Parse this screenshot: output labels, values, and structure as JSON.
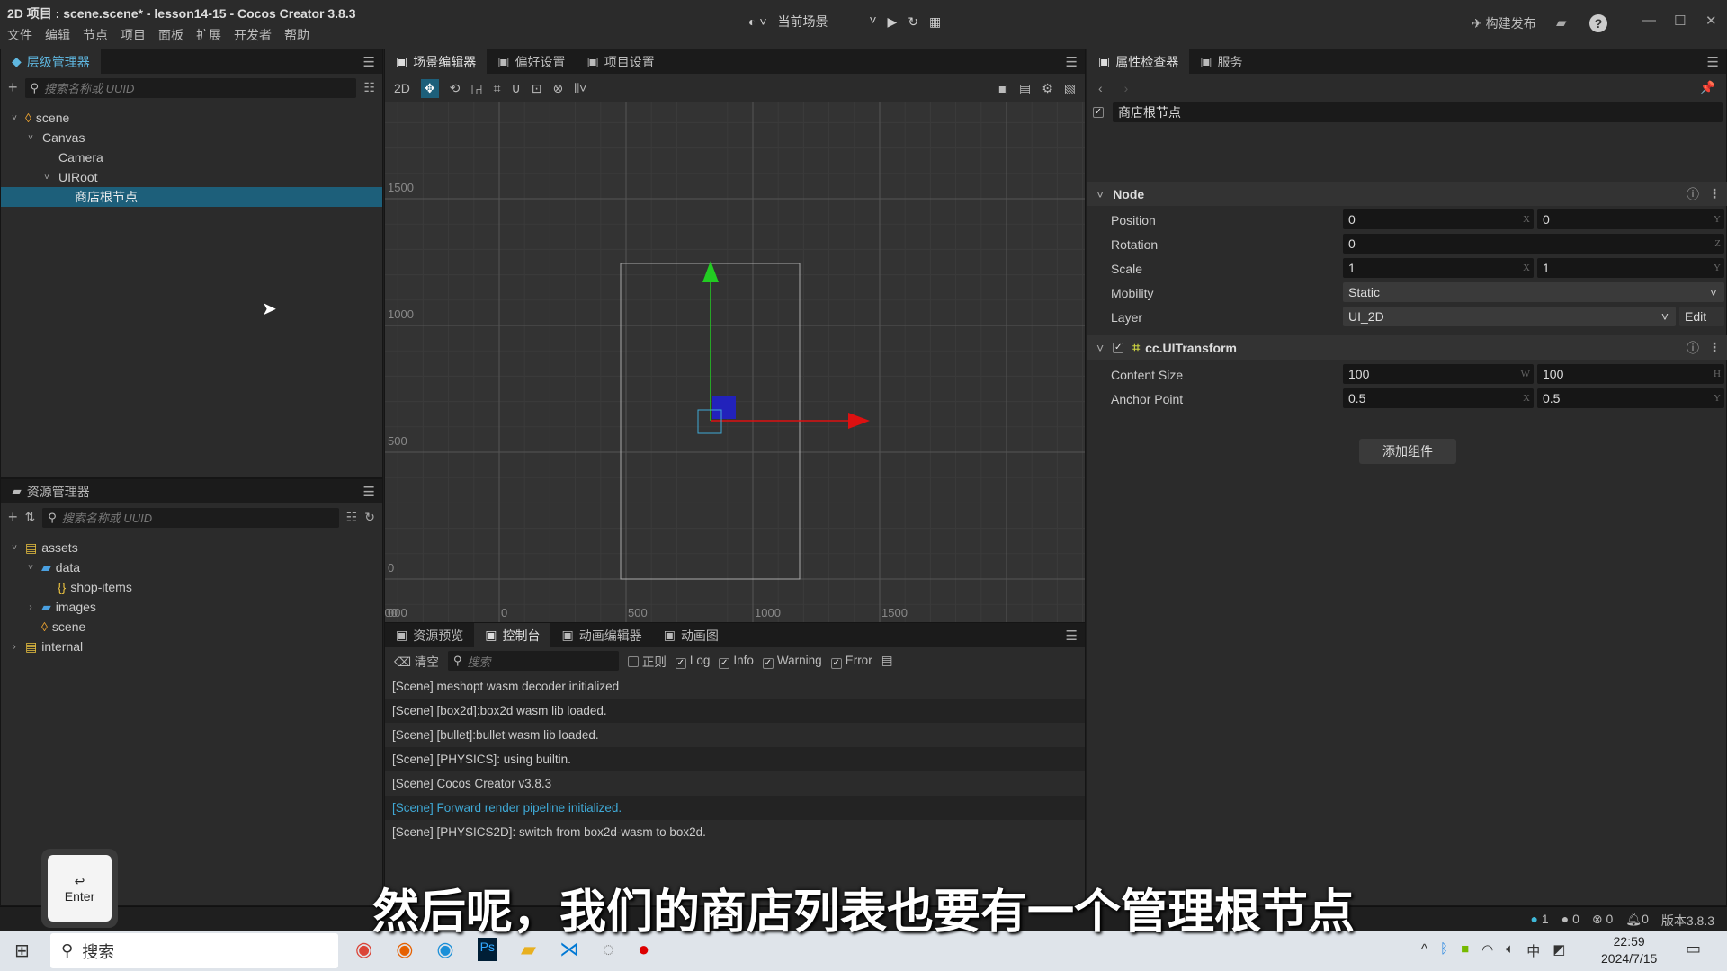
{
  "window": {
    "title": "2D 项目 : scene.scene* - lesson14-15 - Cocos Creator 3.8.3",
    "menu": [
      "文件",
      "编辑",
      "节点",
      "项目",
      "面板",
      "扩展",
      "开发者",
      "帮助"
    ],
    "scene_select": "当前场景",
    "build_label": "构建发布"
  },
  "hierarchy": {
    "tab": "层级管理器",
    "search_placeholder": "搜索名称或 UUID",
    "items": [
      {
        "label": "scene",
        "depth": 0
      },
      {
        "label": "Canvas",
        "depth": 1
      },
      {
        "label": "Camera",
        "depth": 2
      },
      {
        "label": "UIRoot",
        "depth": 2
      },
      {
        "label": "商店根节点",
        "depth": 3,
        "selected": true
      }
    ]
  },
  "assets": {
    "tab": "资源管理器",
    "search_placeholder": "搜索名称或 UUID",
    "items": [
      {
        "label": "assets",
        "depth": 0
      },
      {
        "label": "data",
        "depth": 1
      },
      {
        "label": "shop-items",
        "depth": 2
      },
      {
        "label": "images",
        "depth": 1
      },
      {
        "label": "scene",
        "depth": 1
      },
      {
        "label": "internal",
        "depth": 0
      }
    ]
  },
  "scene_editor": {
    "tabs": [
      "场景编辑器",
      "偏好设置",
      "项目设置"
    ],
    "mode": "2D",
    "y_ticks": [
      "1500",
      "1000",
      "500",
      "0"
    ],
    "x_ticks": [
      "000",
      "-500",
      "0",
      "500",
      "1000",
      "1500"
    ]
  },
  "console": {
    "tabs": [
      "资源预览",
      "控制台",
      "动画编辑器",
      "动画图"
    ],
    "clear": "清空",
    "search_placeholder": "搜索",
    "filters": [
      {
        "label": "正则",
        "checked": false
      },
      {
        "label": "Log",
        "checked": true
      },
      {
        "label": "Info",
        "checked": true
      },
      {
        "label": "Warning",
        "checked": true
      },
      {
        "label": "Error",
        "checked": true
      }
    ],
    "logs": [
      {
        "text": "[Scene] meshopt wasm decoder initialized",
        "color": "#cccccc"
      },
      {
        "text": "[Scene] [box2d]:box2d wasm lib loaded.",
        "color": "#cccccc"
      },
      {
        "text": "[Scene] [bullet]:bullet wasm lib loaded.",
        "color": "#cccccc"
      },
      {
        "text": "[Scene] [PHYSICS]: using builtin.",
        "color": "#cccccc"
      },
      {
        "text": "[Scene] Cocos Creator v3.8.3",
        "color": "#cccccc"
      },
      {
        "text": "[Scene] Forward render pipeline initialized.",
        "color": "#3fa9d6"
      },
      {
        "text": "[Scene] [PHYSICS2D]: switch from box2d-wasm to box2d.",
        "color": "#cccccc"
      }
    ]
  },
  "inspector": {
    "tabs": [
      "属性检查器",
      "服务"
    ],
    "node_name": "商店根节点",
    "node_section": "Node",
    "position": {
      "label": "Position",
      "x": "0",
      "y": "0"
    },
    "rotation": {
      "label": "Rotation",
      "z": "0"
    },
    "scale": {
      "label": "Scale",
      "x": "1",
      "y": "1"
    },
    "mobility": {
      "label": "Mobility",
      "value": "Static"
    },
    "layer": {
      "label": "Layer",
      "value": "UI_2D",
      "edit": "Edit"
    },
    "uitransform": {
      "title": "cc.UITransform",
      "content_size": {
        "label": "Content Size",
        "w": "100",
        "h": "100"
      },
      "anchor": {
        "label": "Anchor Point",
        "x": "0.5",
        "y": "0.5"
      }
    },
    "add_component": "添加组件",
    "units": {
      "x": "X",
      "y": "Y",
      "z": "Z",
      "w": "W",
      "h": "H"
    }
  },
  "status": {
    "info": "1",
    "warn": "0",
    "error": "0",
    "notify": "0",
    "version": "版本3.8.3"
  },
  "taskbar": {
    "search": "搜索",
    "time": "22:59",
    "date": "2024/7/15",
    "ime": "中"
  },
  "overlay": {
    "key": "Enter",
    "subtitle": "然后呢，我们的商店列表也要有一个管理根节点"
  },
  "colors": {
    "accent": "#5fb7e0",
    "selection": "#1d5f7a",
    "gizmo_y": "#22cc22",
    "gizmo_x": "#dd1111"
  }
}
